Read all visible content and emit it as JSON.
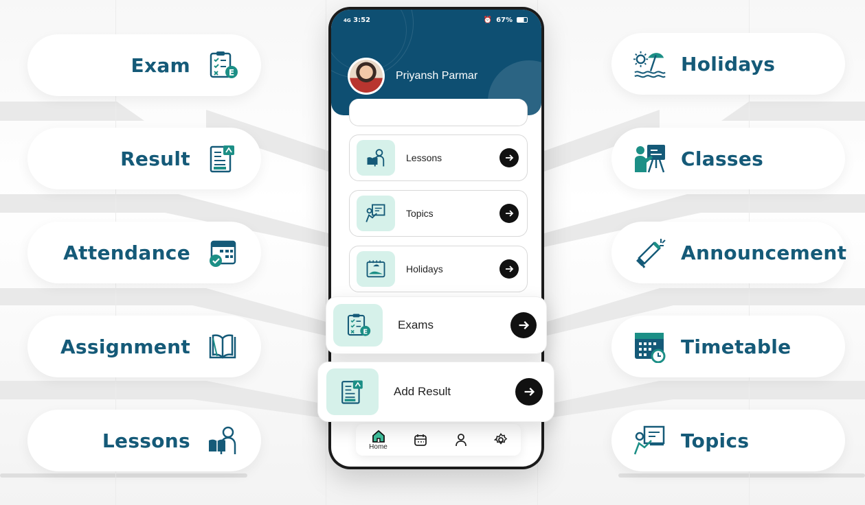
{
  "colors": {
    "brand": "#155a78",
    "header": "#0e4f72",
    "tile": "#d6f1ea",
    "teal": "#1c8f86",
    "dark": "#111111"
  },
  "left_features": [
    {
      "label": "Exam",
      "icon": "exam-checklist-icon"
    },
    {
      "label": "Result",
      "icon": "result-report-icon"
    },
    {
      "label": "Attendance",
      "icon": "attendance-calendar-icon"
    },
    {
      "label": "Assignment",
      "icon": "open-book-icon"
    },
    {
      "label": "Lessons",
      "icon": "lessons-reader-icon"
    }
  ],
  "right_features": [
    {
      "label": "Holidays",
      "icon": "beach-umbrella-icon"
    },
    {
      "label": "Classes",
      "icon": "teacher-board-icon"
    },
    {
      "label": "Announcement",
      "icon": "megaphone-icon"
    },
    {
      "label": "Timetable",
      "icon": "timetable-calendar-icon"
    },
    {
      "label": "Topics",
      "icon": "topics-board-icon"
    }
  ],
  "phone": {
    "status": {
      "time": "3:52",
      "signal": "4G",
      "battery": "67%"
    },
    "user_name": "Priyansh Parmar",
    "rows": [
      {
        "label": "Lessons",
        "icon": "lessons-reader-icon"
      },
      {
        "label": "Topics",
        "icon": "topics-board-icon"
      },
      {
        "label": "Holidays",
        "icon": "beach-photo-icon"
      }
    ],
    "nav": [
      {
        "label": "Home",
        "icon": "home-icon",
        "active": true
      },
      {
        "label": "",
        "icon": "calendar-icon"
      },
      {
        "label": "",
        "icon": "profile-icon"
      },
      {
        "label": "",
        "icon": "settings-icon"
      }
    ]
  },
  "cards": [
    {
      "label": "Exams",
      "icon": "exam-checklist-icon"
    },
    {
      "label": "Add Result",
      "icon": "result-report-icon"
    }
  ]
}
